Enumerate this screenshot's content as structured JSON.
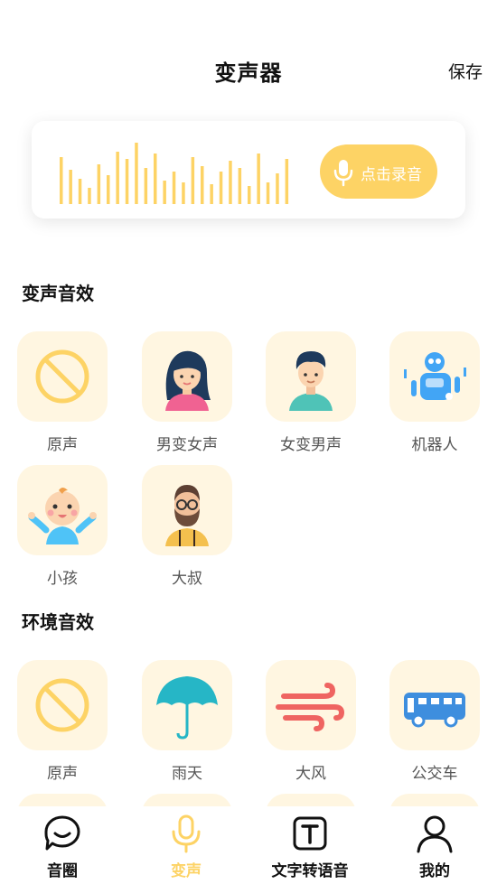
{
  "header": {
    "title": "变声器",
    "save_label": "保存"
  },
  "recorder": {
    "button_label": "点击录音",
    "accent": "#fdd365"
  },
  "sections": [
    {
      "title": "变声音效",
      "items": [
        {
          "label": "原声",
          "icon": "no-effect-icon"
        },
        {
          "label": "男变女声",
          "icon": "female-avatar-icon"
        },
        {
          "label": "女变男声",
          "icon": "male-avatar-icon"
        },
        {
          "label": "机器人",
          "icon": "robot-icon"
        },
        {
          "label": "小孩",
          "icon": "baby-icon"
        },
        {
          "label": "大叔",
          "icon": "uncle-icon"
        }
      ]
    },
    {
      "title": "环境音效",
      "items": [
        {
          "label": "原声",
          "icon": "no-effect-icon"
        },
        {
          "label": "雨天",
          "icon": "umbrella-icon"
        },
        {
          "label": "大风",
          "icon": "wind-icon"
        },
        {
          "label": "公交车",
          "icon": "bus-icon"
        }
      ]
    }
  ],
  "tabbar": [
    {
      "label": "音圈",
      "icon": "chat-bubble-icon",
      "active": false
    },
    {
      "label": "变声",
      "icon": "microphone-icon",
      "active": true
    },
    {
      "label": "文字转语音",
      "icon": "text-icon",
      "active": false
    },
    {
      "label": "我的",
      "icon": "user-icon",
      "active": false
    }
  ],
  "colors": {
    "tile_bg": "#fff6e1",
    "accent": "#fdd365",
    "waveform": "#fdd365"
  }
}
